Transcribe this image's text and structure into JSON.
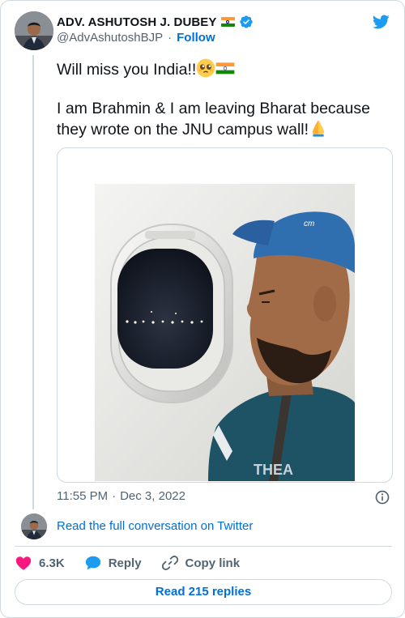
{
  "author": {
    "display_name": "ADV. ASHUTOSH J. DUBEY",
    "handle": "@AdvAshutoshBJP",
    "separator": "·",
    "follow_label": "Follow"
  },
  "tweet": {
    "line1": "Will miss you India!!",
    "line2": "I am Brahmin & I am leaving Bharat because they wrote on the JNU campus wall!",
    "time": "11:55 PM",
    "meta_separator": "·",
    "date": "Dec 3, 2022",
    "photo_cap_text": "cm",
    "photo_shirt_text": "THEA"
  },
  "conversation": {
    "read_full_label": "Read the full conversation on Twitter"
  },
  "actions": {
    "likes": "6.3K",
    "reply_label": "Reply",
    "copy_link_label": "Copy link"
  },
  "replies_button": "Read 215 replies",
  "colors": {
    "link_blue": "#006fd6",
    "twitter_blue": "#1d9bf0",
    "heart_pink": "#f91880",
    "border": "#cfd9de",
    "muted": "#536471"
  }
}
